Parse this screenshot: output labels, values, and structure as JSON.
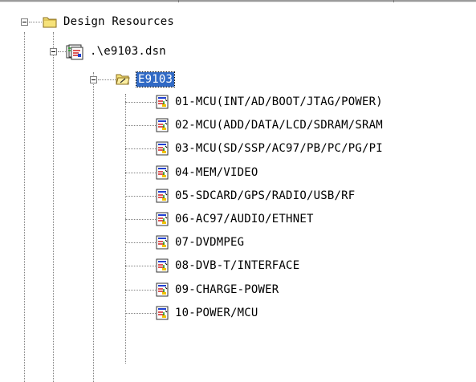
{
  "tree": {
    "root": {
      "label": "Design Resources",
      "icon": "folder-icon"
    },
    "design": {
      "label": ".\\e9103.dsn",
      "icon": "schematic-design-icon"
    },
    "folder": {
      "label": "E9103",
      "icon": "open-folder-icon",
      "selected": true
    },
    "pages": [
      {
        "label": "01-MCU(INT/AD/BOOT/JTAG/POWER)",
        "icon": "schematic-page-icon"
      },
      {
        "label": "02-MCU(ADD/DATA/LCD/SDRAM/SRAM",
        "icon": "schematic-page-icon"
      },
      {
        "label": "03-MCU(SD/SSP/AC97/PB/PC/PG/PI",
        "icon": "schematic-page-icon"
      },
      {
        "label": "04-MEM/VIDEO",
        "icon": "schematic-page-icon"
      },
      {
        "label": "05-SDCARD/GPS/RADIO/USB/RF",
        "icon": "schematic-page-icon"
      },
      {
        "label": "06-AC97/AUDIO/ETHNET",
        "icon": "schematic-page-icon"
      },
      {
        "label": "07-DVDMPEG",
        "icon": "schematic-page-icon"
      },
      {
        "label": "08-DVB-T/INTERFACE",
        "icon": "schematic-page-icon"
      },
      {
        "label": "09-CHARGE-POWER",
        "icon": "schematic-page-icon"
      },
      {
        "label": "10-POWER/MCU",
        "icon": "schematic-page-icon"
      }
    ]
  },
  "colors": {
    "selection": "#316ac5",
    "tree_line": "#808080",
    "folder": "#f6e27a"
  }
}
